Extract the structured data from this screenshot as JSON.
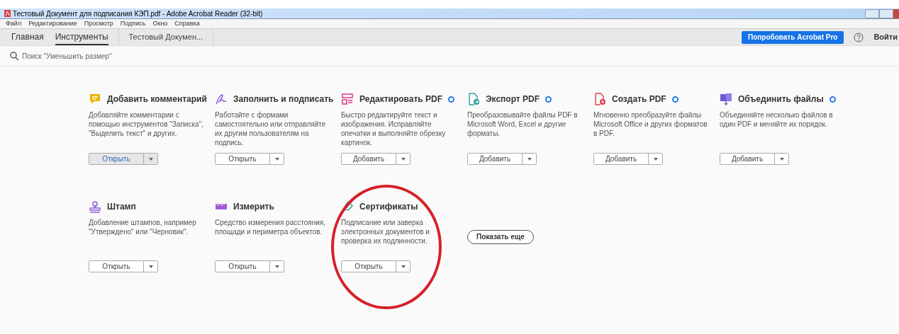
{
  "window": {
    "title": "Тестовый Документ для подписания КЭП.pdf - Adobe Acrobat Reader (32-bit)"
  },
  "menu": [
    "Файл",
    "Редактирование",
    "Просмотр",
    "Подпись",
    "Окно",
    "Справка"
  ],
  "tabs": [
    {
      "label": "Главная",
      "selected": false,
      "kind": "nav"
    },
    {
      "label": "Инструменты",
      "selected": true,
      "kind": "nav"
    },
    {
      "label": "Тестовый Докумен...",
      "selected": false,
      "kind": "document"
    }
  ],
  "try_pro_button": "Попробовать Acrobat Pro",
  "sign_in": "Войти",
  "search": {
    "placeholder": "Поиск \"Уменьшить размер\""
  },
  "tool_rows": [
    [
      {
        "kind": "comment",
        "title": "Добавить комментарий",
        "new": false,
        "description": "Добавляйте комментарии с помощью инструментов \"Записка\", \"Выделить текст\" и других.",
        "button": "Открыть",
        "active": true,
        "circled": false
      },
      {
        "kind": "fill-sign",
        "title": "Заполнить и подписать",
        "new": false,
        "description": "Работайте с формами самостоятельно или отправляйте их другим пользователям на подпись.",
        "button": "Открыть",
        "active": false,
        "circled": false
      },
      {
        "kind": "edit",
        "title": "Редактировать PDF",
        "new": true,
        "description": "Быстро редактируйте текст и изображения. Исправляйте опечатки и выполняйте обрезку картинок.",
        "button": "Добавить",
        "active": false,
        "circled": false
      },
      {
        "kind": "export",
        "title": "Экспорт PDF",
        "new": true,
        "description": "Преобразовывайте файлы PDF в Microsoft Word, Excel и другие форматы.",
        "button": "Добавить",
        "active": false,
        "circled": false
      },
      {
        "kind": "create",
        "title": "Создать PDF",
        "new": true,
        "description": "Мгновенно преобразуйте файлы Microsoft Office и других форматов в PDF.",
        "button": "Добавить",
        "active": false,
        "circled": false
      },
      {
        "kind": "combine",
        "title": "Объединить файлы",
        "new": true,
        "description": "Объединяйте несколько файлов в один PDF и меняйте их порядок.",
        "button": "Добавить",
        "active": false,
        "circled": false
      }
    ],
    [
      {
        "kind": "stamp",
        "title": "Штамп",
        "new": false,
        "description": "Добавление штампов, например \"Утверждено\" или \"Черновик\".",
        "button": "Открыть",
        "active": false,
        "circled": false
      },
      {
        "kind": "measure",
        "title": "Измерить",
        "new": false,
        "description": "Средство измерения расстояния, площади и периметра объектов.",
        "button": "Открыть",
        "active": false,
        "circled": false
      },
      {
        "kind": "certificate",
        "title": "Сертификаты",
        "new": false,
        "description": "Подписание или заверка электронных документов и проверка их подлинности.",
        "button": "Открыть",
        "active": false,
        "circled": true
      }
    ]
  ],
  "show_more_button": "Показать еще"
}
